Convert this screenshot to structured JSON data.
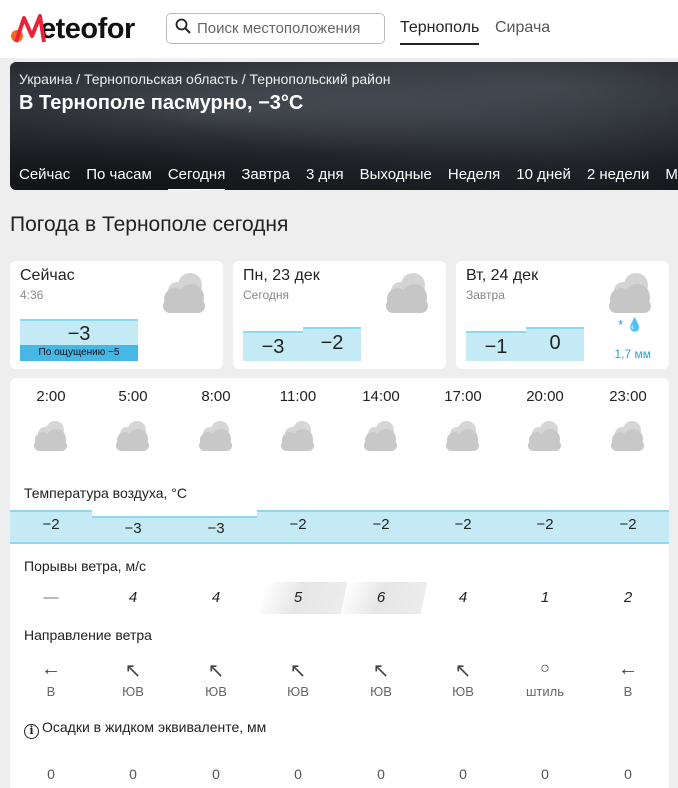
{
  "header": {
    "logo_text": "eteofor",
    "search_placeholder": "Поиск местоположения",
    "city_tabs": [
      "Тернополь",
      "Сирача"
    ]
  },
  "hero": {
    "breadcrumb": "Украина / Тернопольская область / Тернопольский район",
    "title": "В Тернополе пасмурно, −3°C",
    "nav": [
      "Сейчас",
      "По часам",
      "Сегодня",
      "Завтра",
      "3 дня",
      "Выходные",
      "Неделя",
      "10 дней",
      "2 недели",
      "М"
    ],
    "active_nav": "Сегодня"
  },
  "page_title": "Погода в Тернополе сегодня",
  "cards": [
    {
      "title": "Сейчас",
      "subtitle": "4:36",
      "temp": "−3",
      "feels": "По ощущению −5"
    },
    {
      "title": "Пн, 23 дек",
      "subtitle": "Сегодня",
      "min": "−3",
      "max": "−2"
    },
    {
      "title": "Вт, 24 дек",
      "subtitle": "Завтра",
      "min": "−1",
      "max": "0",
      "precip": "1,7 мм",
      "precip_icons": "* 💧"
    }
  ],
  "hourly": {
    "times": [
      "2:00",
      "5:00",
      "8:00",
      "11:00",
      "14:00",
      "17:00",
      "20:00",
      "23:00"
    ],
    "temp_label": "Температура воздуха, °C",
    "temps": [
      "−2",
      "−3",
      "−3",
      "−2",
      "−2",
      "−2",
      "−2",
      "−2"
    ],
    "gust_label": "Порывы ветра, м/с",
    "gusts": [
      "—",
      "4",
      "4",
      "5",
      "6",
      "4",
      "1",
      "2"
    ],
    "dir_label": "Направление ветра",
    "dir_icons": [
      "←",
      "↖",
      "↖",
      "↖",
      "↖",
      "↖",
      "○",
      "←"
    ],
    "dirs": [
      "В",
      "ЮВ",
      "ЮВ",
      "ЮВ",
      "ЮВ",
      "ЮВ",
      "штиль",
      "В"
    ],
    "precip_label": "Осадки в жидком эквиваленте, мм",
    "precip": [
      "0",
      "0",
      "0",
      "0",
      "0",
      "0",
      "0",
      "0"
    ]
  },
  "colors": {
    "accent_orange": "#f26b1d",
    "accent_red": "#e8233a",
    "temp_fill": "#c4eaf6",
    "temp_border": "#8ed8ef",
    "feels_fill": "#47b8e6"
  }
}
